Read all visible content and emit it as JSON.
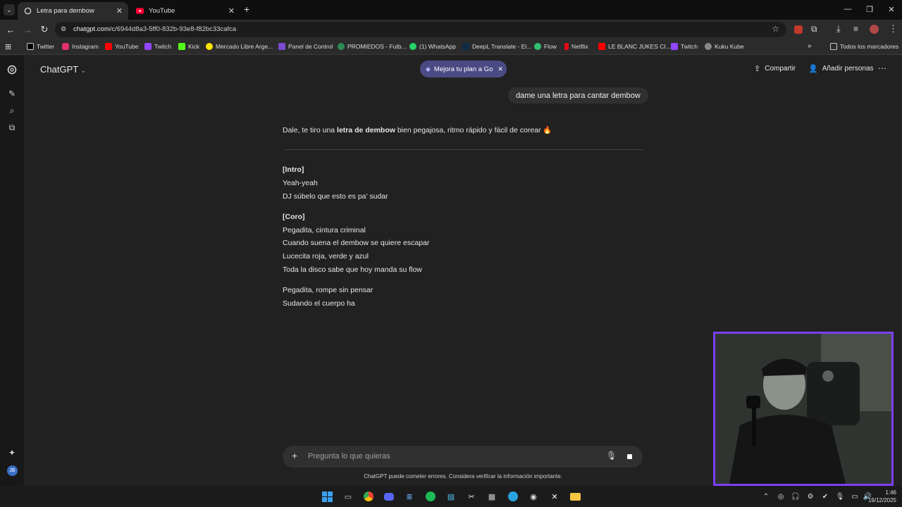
{
  "browser": {
    "tabs": [
      {
        "title": "Letra para dembow",
        "active": true,
        "icon": "chatgpt-icon"
      },
      {
        "title": "YouTube",
        "active": false,
        "icon": "youtube-icon"
      }
    ],
    "url_domain": "chatgpt.com",
    "url_path": "/c/6944d8a3-5ff0-832b-93e8-f82bc33cafca",
    "bookmarks": [
      {
        "label": "Twitter",
        "color": "#000000"
      },
      {
        "label": "Instagram",
        "color": "#e1306c"
      },
      {
        "label": "YouTube",
        "color": "#ff0000"
      },
      {
        "label": "Twitch",
        "color": "#9146ff"
      },
      {
        "label": "Kick",
        "color": "#53fc18"
      },
      {
        "label": "Mercado Libre Arge...",
        "color": "#ffe600"
      },
      {
        "label": "Panel de Control",
        "color": "#7a4bd1"
      },
      {
        "label": "PROMIEDOS - Futb...",
        "color": "#2e8b57"
      },
      {
        "label": "(1) WhatsApp",
        "color": "#25d366"
      },
      {
        "label": "DeepL Translate - El...",
        "color": "#0f2b46"
      },
      {
        "label": "Flow",
        "color": "#2fbf71"
      },
      {
        "label": "Netflix",
        "color": "#e50914"
      },
      {
        "label": "LE BLANC JUKES CI...",
        "color": "#ff0000"
      },
      {
        "label": "Twitch",
        "color": "#9146ff"
      },
      {
        "label": "Kuku Kube",
        "color": "#888888"
      }
    ],
    "all_bookmarks": "Todos los marcadores"
  },
  "app": {
    "model": "ChatGPT",
    "upgrade": "Mejora tu plan a Go",
    "share": "Compartir",
    "add_people": "Añadir personas",
    "user_message": "dame una letra para cantar dembow",
    "reply_pre": "Dale, te tiro una ",
    "reply_bold": "letra de dembow",
    "reply_post": " bien pegajosa, ritmo rápido y fácil de corear 🔥",
    "lyrics": {
      "intro_h": "[Intro]",
      "intro_1": "Yeah-yeah",
      "intro_2": "DJ súbelo que esto es pa’ sudar",
      "coro_h": "[Coro]",
      "coro_1": "Pegadita, cintura criminal",
      "coro_2": "Cuando suena el dembow se quiere escapar",
      "coro_3": "Lucecita roja, verde y azul",
      "coro_4": "Toda la disco sabe que hoy manda su flow",
      "v_1": "Pegadita, rompe sin pensar",
      "v_2": "Sudando el cuerpo ha"
    },
    "composer_placeholder": "Pregunta lo que quieras",
    "disclaimer": "ChatGPT puede cometer errores. Considera verificar la información importante.",
    "user_initials": "JB"
  },
  "taskbar": {
    "time": "1:46",
    "date": "19/12/2025"
  },
  "colors": {
    "accent": "#7b3ff2",
    "upgrade_bg": "#4a4a85"
  }
}
